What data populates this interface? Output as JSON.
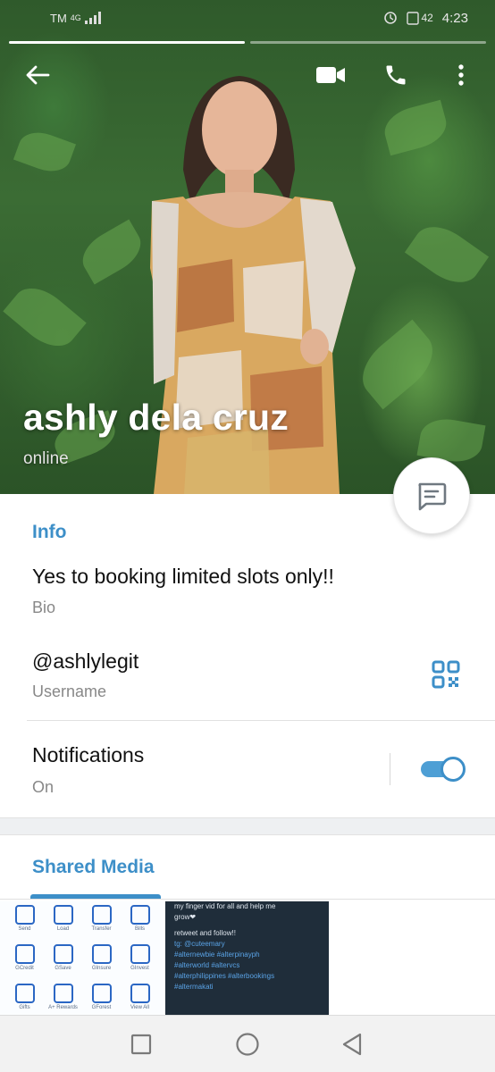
{
  "status_bar": {
    "carrier": "TM",
    "network": "4G",
    "battery": "42",
    "time": "4:23"
  },
  "header": {
    "name": "ashly dela cruz",
    "status": "online",
    "icons": [
      "back-arrow-icon",
      "video-call-icon",
      "phone-icon",
      "more-vert-icon"
    ]
  },
  "fab": {
    "icon": "message-icon"
  },
  "info": {
    "title": "Info",
    "bio_text": "Yes to booking limited slots only!!",
    "bio_label": "Bio",
    "username_text": "@ashlylegit",
    "username_label": "Username",
    "notifications_text": "Notifications",
    "notifications_label": "On",
    "notifications_enabled": true
  },
  "shared_media": {
    "title": "Shared Media",
    "thumb1_labels": [
      "Send",
      "Load",
      "Transfer",
      "Bills",
      "GCredit",
      "GSave",
      "GInsure",
      "GInvest",
      "Gifts",
      "A+ Rewards",
      "GForest",
      "View All"
    ],
    "thumb2_lines": [
      "my finger vid for all and help me",
      "grow❤",
      "retweet and follow!!",
      "tg: @cuteemary",
      "#alternewbie #alterpinayph",
      "#alterworld #altervcs",
      "#alterphilippines #alterbookings",
      "#altermakati"
    ]
  },
  "colors": {
    "accent": "#3d8fc8",
    "toggle_track": "#4e9fd5",
    "nav_bg": "#f2f2f2"
  },
  "nav": {
    "icons": [
      "recents-square-icon",
      "home-circle-icon",
      "back-triangle-icon"
    ]
  }
}
